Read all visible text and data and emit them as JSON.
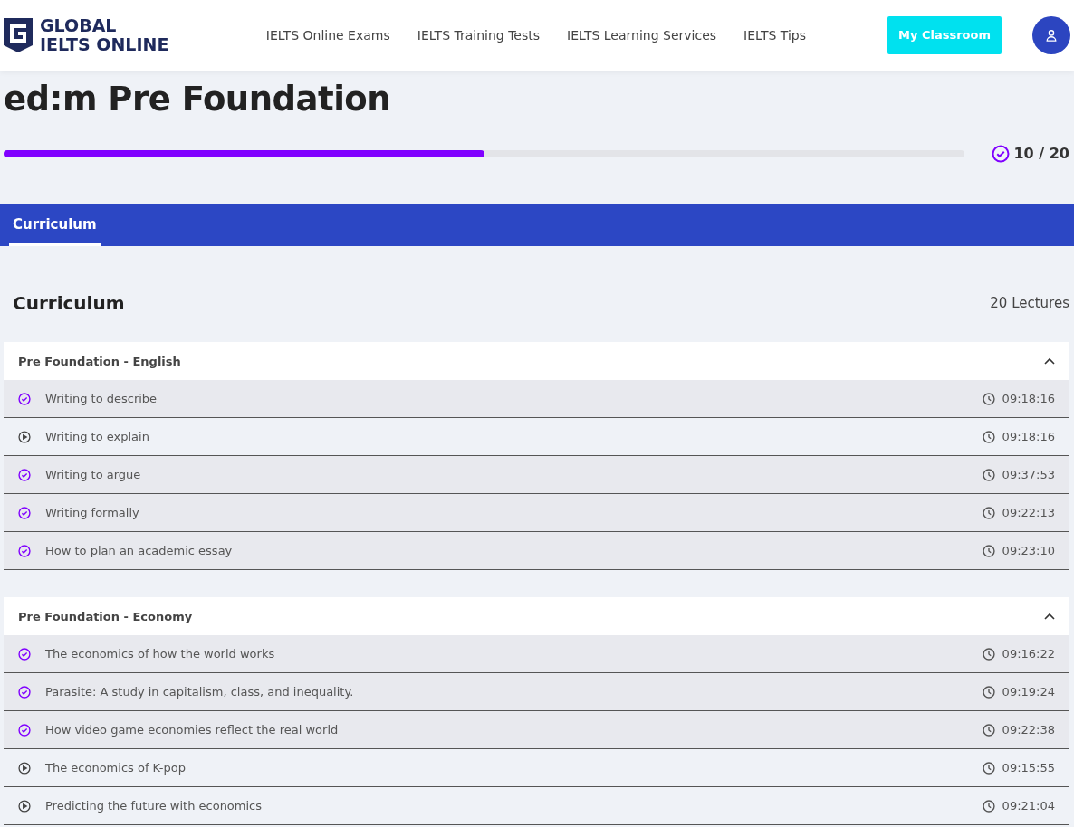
{
  "header": {
    "logo": [
      "GLOBAL",
      "IELTS ONLINE"
    ],
    "nav": [
      "IELTS Online Exams",
      "IELTS Training Tests",
      "IELTS Learning Services",
      "IELTS Tips"
    ],
    "classroom_button": "My Classroom"
  },
  "course": {
    "title": "ed:m Pre Foundation",
    "progress": {
      "level": 0.5,
      "reading": "10 / 20"
    }
  },
  "tabs": [
    {
      "label": "Curriculum",
      "selected": true
    }
  ],
  "curriculum": {
    "title": "Curriculum",
    "count": "20 Lectures",
    "sections": [
      {
        "title": "Pre Foundation - English",
        "expanded": true,
        "lectures": [
          {
            "title": "Writing to describe",
            "completed": true,
            "duration": "09:18:16"
          },
          {
            "title": "Writing to explain",
            "completed": false,
            "duration": "09:18:16"
          },
          {
            "title": "Writing to argue",
            "completed": true,
            "duration": "09:37:53"
          },
          {
            "title": "Writing formally",
            "completed": true,
            "duration": "09:22:13"
          },
          {
            "title": "How to plan an academic essay",
            "completed": true,
            "duration": "09:23:10"
          }
        ]
      },
      {
        "title": "Pre Foundation - Economy",
        "expanded": true,
        "lectures": [
          {
            "title": "The economics of how the world works",
            "completed": true,
            "duration": "09:16:22"
          },
          {
            "title": "Parasite: A study in capitalism, class, and inequality.",
            "completed": true,
            "duration": "09:19:24"
          },
          {
            "title": "How video game economies reflect the real world",
            "completed": true,
            "duration": "09:22:38"
          },
          {
            "title": "The economics of K-pop",
            "completed": false,
            "duration": "09:15:55"
          },
          {
            "title": "Predicting the future with economics",
            "completed": false,
            "duration": "09:21:04"
          }
        ]
      }
    ]
  }
}
